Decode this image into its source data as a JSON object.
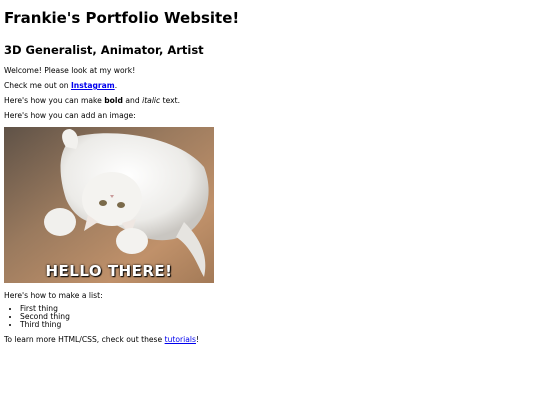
{
  "header": {
    "title": "Frankie's Portfolio Website!",
    "subtitle": "3D Generalist, Animator, Artist"
  },
  "intro": {
    "welcome": "Welcome! Please look at my work!",
    "check_prefix": "Check me out on ",
    "instagram_link": "Instagram",
    "check_suffix": "."
  },
  "formatting": {
    "prefix": "Here's how you can make ",
    "bold": "bold",
    "middle": " and ",
    "italic": "italic",
    "suffix": " text."
  },
  "image_section": {
    "lead": "Here's how you can add an image:",
    "caption": "HELLO THERE!",
    "icon": "cat-photo"
  },
  "list_section": {
    "lead": "Here's how to make a list:",
    "items": [
      "First thing",
      "Second thing",
      "Third thing"
    ]
  },
  "footer": {
    "prefix": "To learn more HTML/CSS, check out these ",
    "tutorials_link": "tutorials",
    "suffix": "!"
  },
  "colors": {
    "link": "#0000ee",
    "text": "#000000",
    "background": "#ffffff"
  }
}
